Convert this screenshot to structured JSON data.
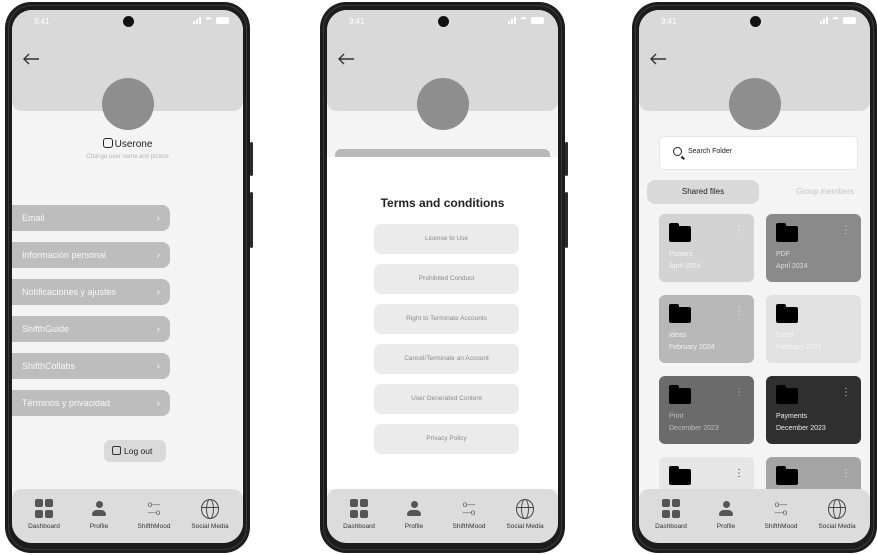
{
  "status": {
    "time": "9:41"
  },
  "nav": [
    {
      "label": "Dashboard",
      "icon": "grid-icon"
    },
    {
      "label": "Profile",
      "icon": "person-icon"
    },
    {
      "label": "ShifthMood",
      "icon": "sliders-icon"
    },
    {
      "label": "Social Media",
      "icon": "globe-icon"
    }
  ],
  "profile": {
    "username": "Userone",
    "caption": "Change user name and picture",
    "menu": [
      "Email",
      "Información personal",
      "Notificaciones y ajustes",
      "ShifthGuide",
      "ShifthCollabs",
      "Términos y privacidad"
    ],
    "logout": "Log out"
  },
  "terms": {
    "title": "Terms and conditions",
    "items": [
      "License to Use",
      "Prohibited Conduct",
      "Right to Terminate Accounts",
      "Cancel/Terminate an Account",
      "User Generated Content",
      "Privacy Policy"
    ]
  },
  "files": {
    "search_placeholder": "Search Folder",
    "tabs": [
      "Shared files",
      "Group members"
    ],
    "folders": [
      {
        "name": "Posters",
        "date": "April 2024",
        "bg": "#d3d3d3",
        "fg": "#f5f5f5"
      },
      {
        "name": "PDF",
        "date": "April 2024",
        "bg": "#8a8a8a",
        "fg": "#dcdcdc"
      },
      {
        "name": "Ideas",
        "date": "February 2024",
        "bg": "#b8b8b8",
        "fg": "#f2f2f2"
      },
      {
        "name": "Excel",
        "date": "February 2024",
        "bg": "#e1e1e1",
        "fg": "#f5f5f5"
      },
      {
        "name": "Print",
        "date": "December 2023",
        "bg": "#6b6b6b",
        "fg": "#bdbdbd"
      },
      {
        "name": "Payments",
        "date": "December 2023",
        "bg": "#2f2f2f",
        "fg": "#ededed"
      },
      {
        "name": "",
        "date": "",
        "bg": "#e6e6e6",
        "fg": "#222222"
      },
      {
        "name": "",
        "date": "",
        "bg": "#a4a4a4",
        "fg": "#eeeeee"
      }
    ]
  }
}
